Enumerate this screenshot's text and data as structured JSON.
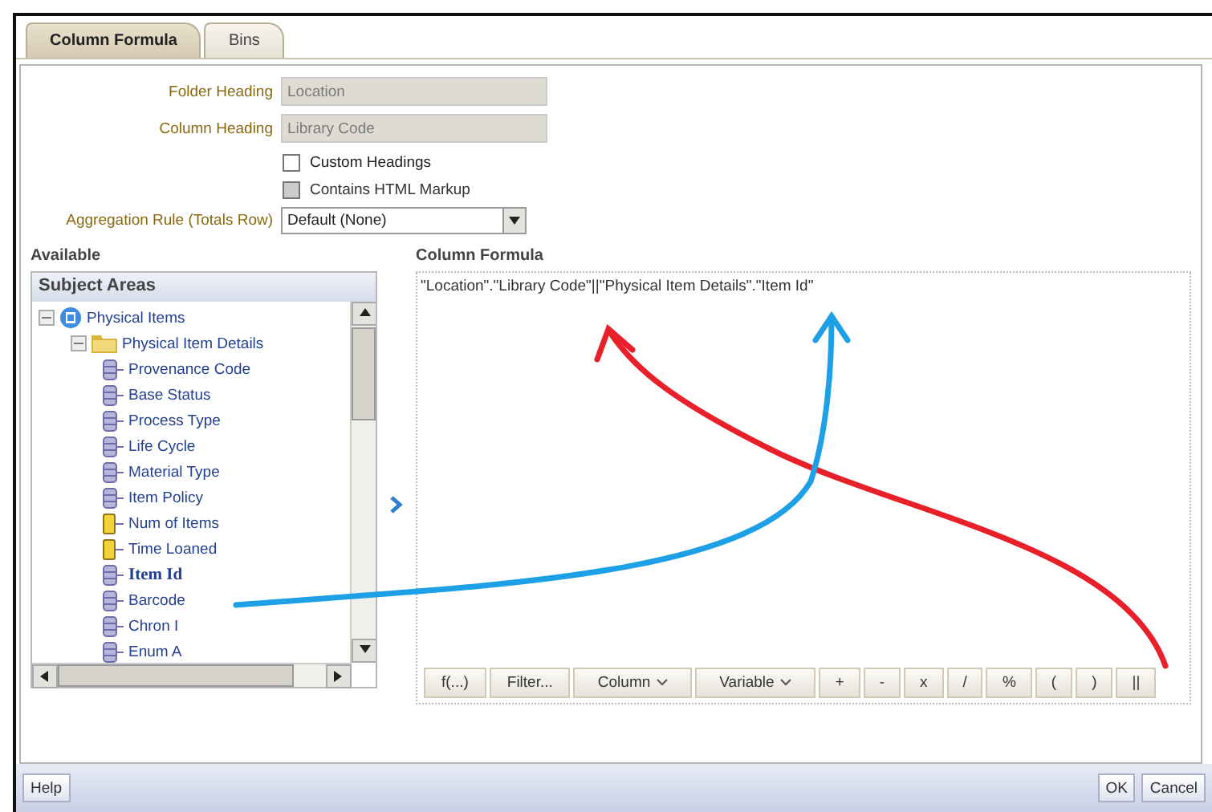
{
  "tabs": [
    {
      "label": "Column Formula",
      "selected": true
    },
    {
      "label": "Bins",
      "selected": false
    }
  ],
  "fields": [
    {
      "label": "Folder Heading",
      "value": "Location",
      "disabled": true
    },
    {
      "label": "Column Heading",
      "value": "Library Code",
      "disabled": true
    }
  ],
  "checkboxes": [
    {
      "label": "Custom Headings",
      "checked": false,
      "disabled": false
    },
    {
      "label": "Contains HTML Markup",
      "checked": false,
      "disabled": true
    }
  ],
  "aggregation": {
    "label": "Aggregation Rule (Totals Row)",
    "value": "Default (None)"
  },
  "available": {
    "heading": "Available",
    "panel_title": "Subject Areas",
    "tree": [
      {
        "label": "Physical Items",
        "kind": "subject",
        "expanded": true,
        "selected": false,
        "children": [
          {
            "label": "Physical Item Details",
            "kind": "folder",
            "expanded": true,
            "selected": false,
            "children": [
              {
                "label": "Provenance Code",
                "kind": "column",
                "selected": false
              },
              {
                "label": "Base Status",
                "kind": "column",
                "selected": false
              },
              {
                "label": "Process Type",
                "kind": "column",
                "selected": false
              },
              {
                "label": "Life Cycle",
                "kind": "column",
                "selected": false
              },
              {
                "label": "Material Type",
                "kind": "column",
                "selected": false
              },
              {
                "label": "Item Policy",
                "kind": "column",
                "selected": false
              },
              {
                "label": "Num of Items",
                "kind": "measure",
                "selected": false
              },
              {
                "label": "Time Loaned",
                "kind": "measure",
                "selected": false
              },
              {
                "label": "Item Id",
                "kind": "column",
                "selected": true
              },
              {
                "label": "Barcode",
                "kind": "column",
                "selected": false
              },
              {
                "label": "Chron I",
                "kind": "column",
                "selected": false
              },
              {
                "label": "Enum A",
                "kind": "column",
                "selected": false
              }
            ]
          }
        ]
      }
    ]
  },
  "formula": {
    "heading": "Column Formula",
    "text": "\"Location\".\"Library Code\"||\"Physical Item Details\".\"Item Id\"",
    "toolbar": [
      {
        "label": "f(...)",
        "dropdown": false
      },
      {
        "label": "Filter...",
        "dropdown": false
      },
      {
        "label": "Column",
        "dropdown": true
      },
      {
        "label": "Variable",
        "dropdown": true
      },
      {
        "label": "+",
        "dropdown": false
      },
      {
        "label": "-",
        "dropdown": false
      },
      {
        "label": "x",
        "dropdown": false
      },
      {
        "label": "/",
        "dropdown": false
      },
      {
        "label": "%",
        "dropdown": false
      },
      {
        "label": "(",
        "dropdown": false
      },
      {
        "label": ")",
        "dropdown": false
      },
      {
        "label": "||",
        "dropdown": false
      }
    ]
  },
  "footer": {
    "help": "Help",
    "ok": "OK",
    "cancel": "Cancel"
  }
}
